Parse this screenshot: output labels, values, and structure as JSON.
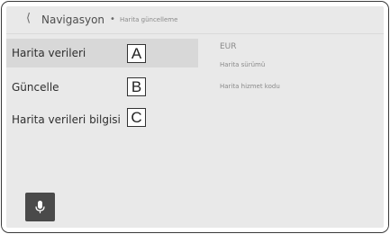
{
  "header": {
    "back_icon": "chevron-left-icon",
    "title": "Navigasyon",
    "separator": "•",
    "subtitle": "Harita güncelleme"
  },
  "menu": [
    {
      "label": "Harita verileri",
      "callout": "A",
      "selected": true
    },
    {
      "label": "Güncelle",
      "callout": "B",
      "selected": false
    },
    {
      "label": "Harita verileri bilgisi",
      "callout": "C",
      "selected": false
    }
  ],
  "info": {
    "region": "EUR",
    "version_label": "Harita sürümü",
    "service_code_label": "Harita hizmet kodu"
  },
  "voice_button": {
    "icon": "microphone-icon"
  }
}
